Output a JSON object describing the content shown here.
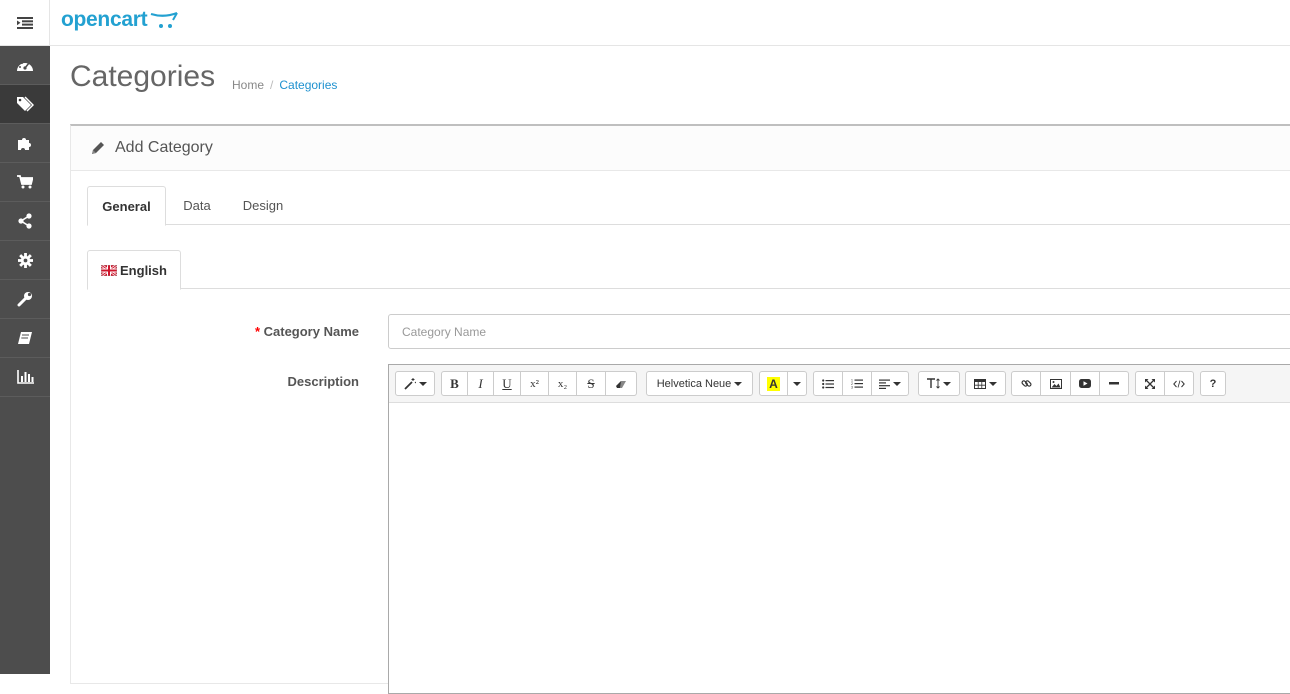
{
  "header": {
    "logo_text": "opencart"
  },
  "sidebar": {
    "items": [
      {
        "icon": "dashboard-icon"
      },
      {
        "icon": "tags-icon",
        "active": true
      },
      {
        "icon": "puzzle-icon"
      },
      {
        "icon": "cart-icon"
      },
      {
        "icon": "share-icon"
      },
      {
        "icon": "cog-icon"
      },
      {
        "icon": "wrench-icon"
      },
      {
        "icon": "book-icon"
      },
      {
        "icon": "bar-chart-icon"
      }
    ]
  },
  "page": {
    "title": "Categories",
    "breadcrumb": {
      "home": "Home",
      "sep": "/",
      "current": "Categories"
    }
  },
  "panel": {
    "title": "Add Category"
  },
  "tabs": {
    "general": "General",
    "data": "Data",
    "design": "Design"
  },
  "language_tab": {
    "label": "English"
  },
  "form": {
    "category_name": {
      "required_mark": "*",
      "label": "Category Name",
      "placeholder": "Category Name",
      "value": ""
    },
    "description": {
      "label": "Description"
    }
  },
  "editor": {
    "font_name": "Helvetica Neue",
    "bold": "B",
    "italic": "I",
    "underline": "U",
    "superscript": "x²",
    "subscript": "x₂",
    "strike": "S",
    "help": "?",
    "highlight_letter": "A",
    "highlight_color": "#ffff00"
  },
  "colors": {
    "accent": "#1e91cf",
    "logo": "#23a1d1",
    "sidebar": "#4d4d4d"
  }
}
